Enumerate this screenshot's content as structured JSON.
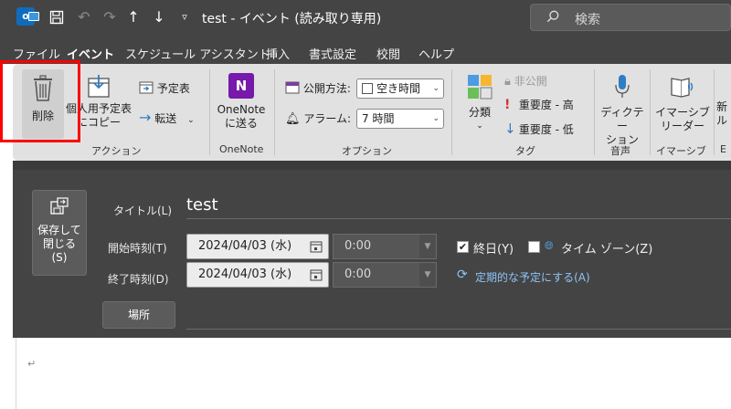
{
  "titlebar": {
    "app_icon_letter": "o",
    "title": "test  -  イベント (読み取り専用)",
    "search_placeholder": "検索",
    "save_icon": "save-icon",
    "undo_icon": "undo-icon",
    "redo_icon": "redo-icon"
  },
  "tabs": [
    {
      "label": "ファイル",
      "active": false
    },
    {
      "label": "イベント",
      "active": true
    },
    {
      "label": "スケジュール アシスタント",
      "active": false
    },
    {
      "label": "挿入",
      "active": false
    },
    {
      "label": "書式設定",
      "active": false
    },
    {
      "label": "校閲",
      "active": false
    },
    {
      "label": "ヘルプ",
      "active": false
    }
  ],
  "ribbon": {
    "actions": {
      "group_label": "アクション",
      "delete_label": "削除",
      "copy_label_1": "個人用予定表",
      "copy_label_2": "にコピー",
      "calendar_label": "予定表",
      "forward_label": "転送"
    },
    "onenote": {
      "group_label": "OneNote",
      "send_label_1": "OneNote",
      "send_label_2": "に送る"
    },
    "options": {
      "group_label": "オプション",
      "show_as_label": "公開方法:",
      "show_as_value": "空き時間",
      "alarm_label": "アラーム:",
      "alarm_value": "7 時間"
    },
    "tags": {
      "group_label": "タグ",
      "categorize_label": "分類",
      "private_label": "非公開",
      "high_label": "重要度 - 高",
      "low_label": "重要度 - 低"
    },
    "voice": {
      "group_label": "音声",
      "dictate_label_1": "ディクテー",
      "dictate_label_2": "ション"
    },
    "immersive": {
      "group_label": "イマーシブ",
      "reader_label_1": "イマーシブ",
      "reader_label_2": "リーダー"
    },
    "extra": {
      "label_1": "新",
      "label_2": "ル",
      "group_label": "E"
    }
  },
  "form": {
    "save_close_1": "保存して",
    "save_close_2": "閉じる",
    "save_close_3": "(S)",
    "title_label": "タイトル(L)",
    "title_value": "test",
    "start_label": "開始時刻(T)",
    "start_date": "2024/04/03 (水)",
    "start_time": "0:00",
    "end_label": "終了時刻(D)",
    "end_date": "2024/04/03 (水)",
    "end_time": "0:00",
    "all_day_label": "終日(Y)",
    "all_day_checked": "✔",
    "timezone_label": "タイム ゾーン(Z)",
    "recurring_label": "定期的な予定にする(A)",
    "location_label": "場所"
  },
  "body": {
    "para_mark": "↵"
  }
}
